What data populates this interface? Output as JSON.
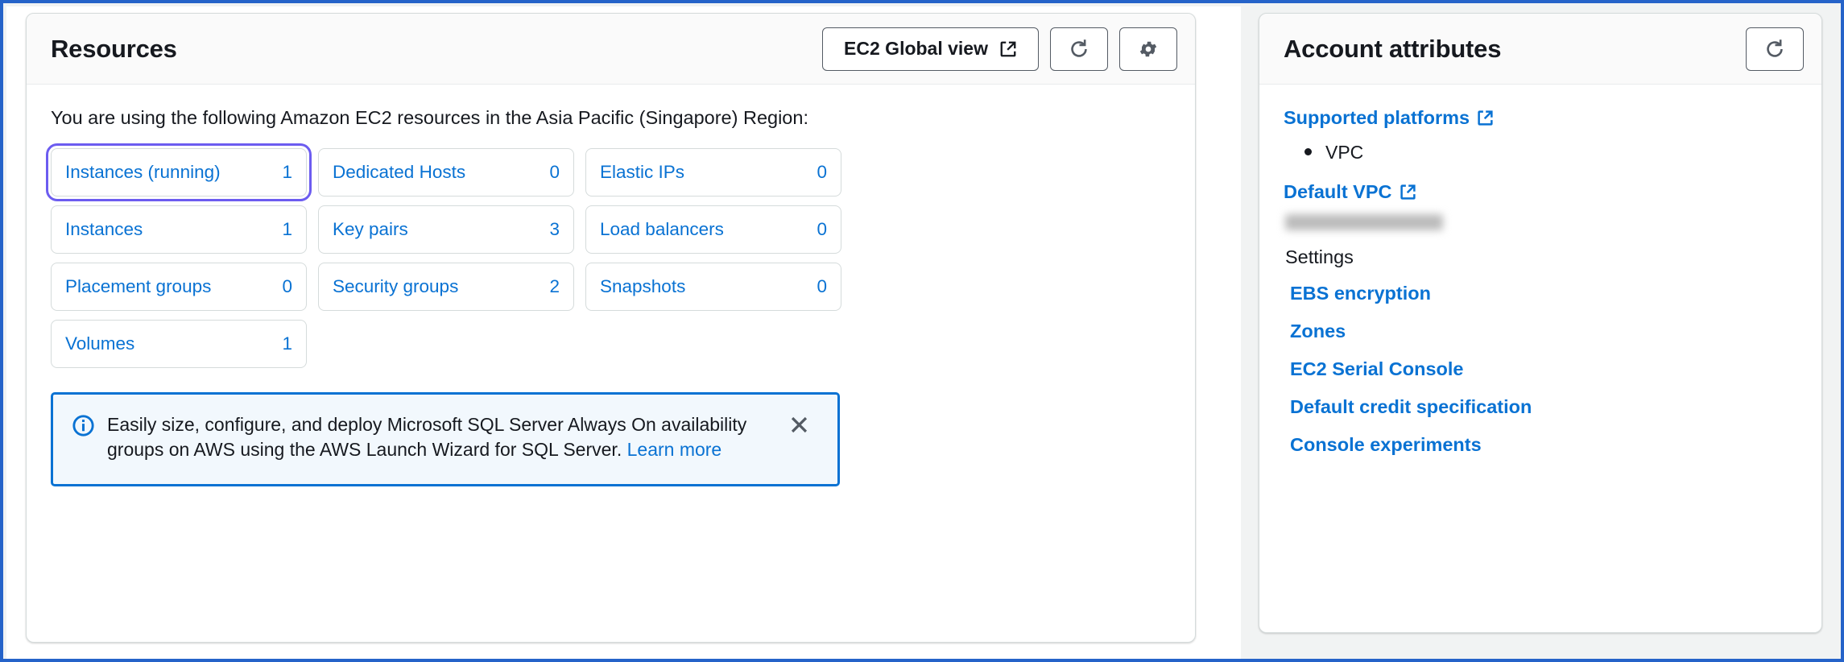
{
  "resources": {
    "title": "Resources",
    "global_view_button": "EC2 Global view",
    "refresh_icon": "refresh-icon",
    "settings_icon": "gear-icon",
    "external_link_icon": "external-link-icon",
    "region_note": "You are using the following Amazon EC2 resources in the Asia Pacific (Singapore) Region:",
    "tiles": [
      {
        "label": "Instances (running)",
        "count": "1",
        "focused": true
      },
      {
        "label": "Instances",
        "count": "1",
        "focused": false
      },
      {
        "label": "Placement groups",
        "count": "0",
        "focused": false
      },
      {
        "label": "Volumes",
        "count": "1",
        "focused": false
      },
      {
        "label": "Dedicated Hosts",
        "count": "0",
        "focused": false
      },
      {
        "label": "Key pairs",
        "count": "3",
        "focused": false
      },
      {
        "label": "Security groups",
        "count": "2",
        "focused": false
      },
      {
        "label": "Elastic IPs",
        "count": "0",
        "focused": false
      },
      {
        "label": "Load balancers",
        "count": "0",
        "focused": false
      },
      {
        "label": "Snapshots",
        "count": "0",
        "focused": false
      }
    ],
    "banner": {
      "icon": "info-circle-icon",
      "text_line_1": "Easily size, configure, and deploy Microsoft SQL Server Always On availability groups on AWS",
      "text_line_2": "using the AWS Launch Wizard for SQL Server. ",
      "link_text": "Learn more",
      "close_icon": "close-icon"
    }
  },
  "account_attributes": {
    "title": "Account attributes",
    "refresh_icon": "refresh-icon",
    "supported_platforms_link": "Supported platforms",
    "platforms": [
      "VPC"
    ],
    "default_vpc_link": "Default VPC",
    "default_vpc_value": "",
    "settings_label": "Settings",
    "settings_links": [
      "EBS encryption",
      "Zones",
      "EC2 Serial Console",
      "Default credit specification",
      "Console experiments"
    ]
  },
  "colors": {
    "link_blue": "#0972d3",
    "focus_purple": "#6c5cf0",
    "banner_bg": "#f2f8fd",
    "border_gray": "#d5dbdb",
    "frame_blue": "#2563c9"
  }
}
